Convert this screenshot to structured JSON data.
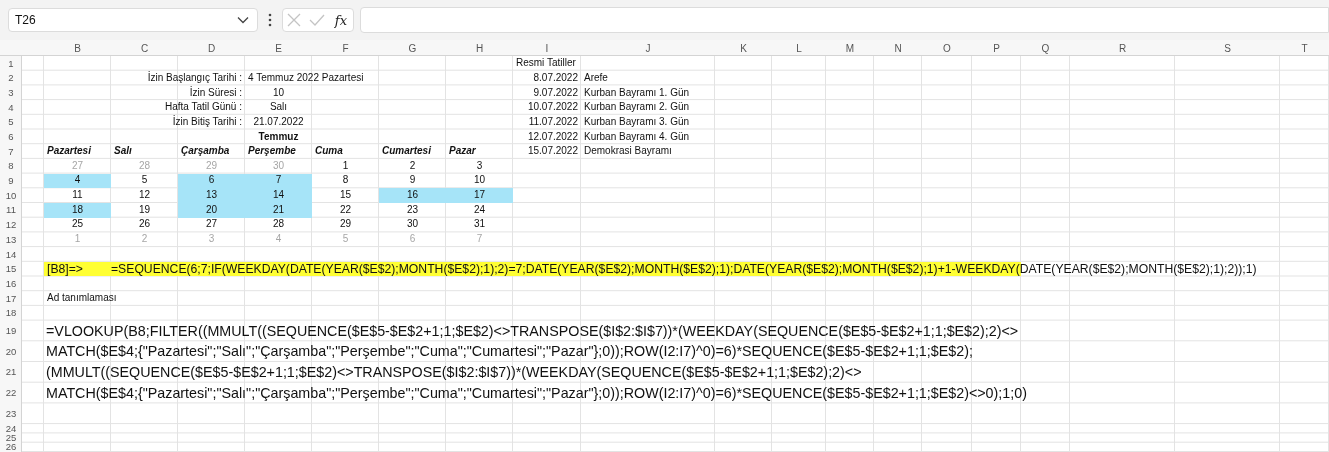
{
  "name_box": {
    "value": "T26"
  },
  "formula_bar": {
    "function_label": "fx"
  },
  "column_headers": [
    "B",
    "C",
    "D",
    "E",
    "F",
    "G",
    "H",
    "I",
    "J",
    "K",
    "L",
    "M",
    "N",
    "O",
    "P",
    "Q",
    "R",
    "S",
    "T"
  ],
  "row_numbers": [
    "1",
    "2",
    "3",
    "4",
    "5",
    "6",
    "7",
    "8",
    "9",
    "10",
    "11",
    "12",
    "13",
    "14",
    "15",
    "16",
    "17",
    "18",
    "19",
    "20",
    "21",
    "22",
    "23",
    "24",
    "25",
    "26"
  ],
  "leave_form": [
    {
      "label": "İzin Başlangıç Tarihi :",
      "value": "4 Temmuz 2022 Pazartesi"
    },
    {
      "label": "İzin Süresi :",
      "value": "10"
    },
    {
      "label": "Hafta Tatil Günü :",
      "value": "Salı"
    },
    {
      "label": "İzin Bitiş Tarihi :",
      "value": "21.07.2022"
    }
  ],
  "calendar": {
    "month": "Temmuz",
    "weekdays": [
      "Pazartesi",
      "Salı",
      "Çarşamba",
      "Perşembe",
      "Cuma",
      "Cumartesi",
      "Pazar"
    ],
    "weeks": [
      [
        {
          "day": "27",
          "other_month": true,
          "leave": false
        },
        {
          "day": "28",
          "other_month": true,
          "leave": false
        },
        {
          "day": "29",
          "other_month": true,
          "leave": false
        },
        {
          "day": "30",
          "other_month": true,
          "leave": false
        },
        {
          "day": "1",
          "other_month": false,
          "leave": false
        },
        {
          "day": "2",
          "other_month": false,
          "leave": false
        },
        {
          "day": "3",
          "other_month": false,
          "leave": false
        }
      ],
      [
        {
          "day": "4",
          "other_month": false,
          "leave": true
        },
        {
          "day": "5",
          "other_month": false,
          "leave": false
        },
        {
          "day": "6",
          "other_month": false,
          "leave": true
        },
        {
          "day": "7",
          "other_month": false,
          "leave": true
        },
        {
          "day": "8",
          "other_month": false,
          "leave": false
        },
        {
          "day": "9",
          "other_month": false,
          "leave": false
        },
        {
          "day": "10",
          "other_month": false,
          "leave": false
        }
      ],
      [
        {
          "day": "11",
          "other_month": false,
          "leave": false
        },
        {
          "day": "12",
          "other_month": false,
          "leave": false
        },
        {
          "day": "13",
          "other_month": false,
          "leave": true
        },
        {
          "day": "14",
          "other_month": false,
          "leave": true
        },
        {
          "day": "15",
          "other_month": false,
          "leave": false
        },
        {
          "day": "16",
          "other_month": false,
          "leave": true
        },
        {
          "day": "17",
          "other_month": false,
          "leave": true
        }
      ],
      [
        {
          "day": "18",
          "other_month": false,
          "leave": true
        },
        {
          "day": "19",
          "other_month": false,
          "leave": false
        },
        {
          "day": "20",
          "other_month": false,
          "leave": true
        },
        {
          "day": "21",
          "other_month": false,
          "leave": true
        },
        {
          "day": "22",
          "other_month": false,
          "leave": false
        },
        {
          "day": "23",
          "other_month": false,
          "leave": false
        },
        {
          "day": "24",
          "other_month": false,
          "leave": false
        }
      ],
      [
        {
          "day": "25",
          "other_month": false,
          "leave": false
        },
        {
          "day": "26",
          "other_month": false,
          "leave": false
        },
        {
          "day": "27",
          "other_month": false,
          "leave": false
        },
        {
          "day": "28",
          "other_month": false,
          "leave": false
        },
        {
          "day": "29",
          "other_month": false,
          "leave": false
        },
        {
          "day": "30",
          "other_month": false,
          "leave": false
        },
        {
          "day": "31",
          "other_month": false,
          "leave": false
        }
      ],
      [
        {
          "day": "1",
          "other_month": true,
          "leave": false
        },
        {
          "day": "2",
          "other_month": true,
          "leave": false
        },
        {
          "day": "3",
          "other_month": true,
          "leave": false
        },
        {
          "day": "4",
          "other_month": true,
          "leave": false
        },
        {
          "day": "5",
          "other_month": true,
          "leave": false
        },
        {
          "day": "6",
          "other_month": true,
          "leave": false
        },
        {
          "day": "7",
          "other_month": true,
          "leave": false
        }
      ]
    ]
  },
  "holidays": {
    "title": "Resmi Tatiller",
    "items": [
      {
        "date": "8.07.2022",
        "name": "Arefe"
      },
      {
        "date": "9.07.2022",
        "name": "Kurban Bayramı 1. Gün"
      },
      {
        "date": "10.07.2022",
        "name": "Kurban Bayramı 2. Gün"
      },
      {
        "date": "11.07.2022",
        "name": "Kurban Bayramı 3. Gün"
      },
      {
        "date": "12.07.2022",
        "name": "Kurban Bayramı 4. Gün"
      },
      {
        "date": "15.07.2022",
        "name": "Demokrasi Bayramı"
      }
    ]
  },
  "note": {
    "cell_ref": "[B8]=>",
    "formula": "=SEQUENCE(6;7;IF(WEEKDAY(DATE(YEAR($E$2);MONTH($E$2);1);2)=7;DATE(YEAR($E$2);MONTH($E$2);1);DATE(YEAR($E$2);MONTH($E$2);1)+1-WEEKDAY(DATE(YEAR($E$2);MONTH($E$2);1);2));1)"
  },
  "name_definition": {
    "title": "Ad tanımlaması",
    "lines": [
      "=VLOOKUP(B8;FILTER((MMULT((SEQUENCE($E$5-$E$2+1;1;$E$2)<>TRANSPOSE($I$2:$I$7))*(WEEKDAY(SEQUENCE($E$5-$E$2+1;1;$E$2);2)<>",
      "MATCH($E$4;{\"Pazartesi\";\"Salı\";\"Çarşamba\";\"Perşembe\";\"Cuma\";\"Cumartesi\";\"Pazar\"};0));ROW(I2:I7)^0)=6)*SEQUENCE($E$5-$E$2+1;1;$E$2);",
      "(MMULT((SEQUENCE($E$5-$E$2+1;1;$E$2)<>TRANSPOSE($I$2:$I$7))*(WEEKDAY(SEQUENCE($E$5-$E$2+1;1;$E$2);2)<>",
      "MATCH($E$4;{\"Pazartesi\";\"Salı\";\"Çarşamba\";\"Perşembe\";\"Cuma\";\"Cumartesi\";\"Pazar\"};0));ROW(I2:I7)^0)=6)*SEQUENCE($E$5-$E$2+1;1;$E$2)<>0);1;0)"
    ]
  }
}
